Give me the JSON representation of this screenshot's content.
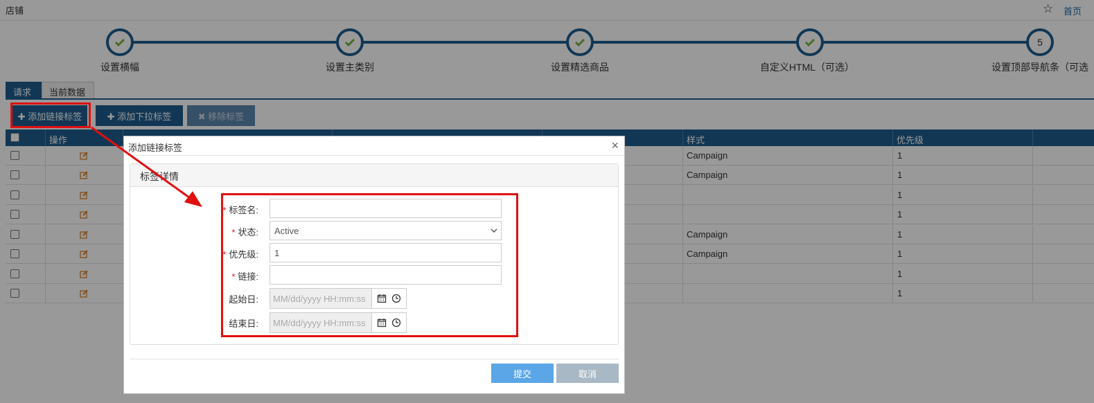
{
  "topbar": {
    "title": "店铺",
    "home": "首页"
  },
  "steps": [
    {
      "label": "设置横幅",
      "done": true
    },
    {
      "label": "设置主类别",
      "done": true
    },
    {
      "label": "设置精选商品",
      "done": true
    },
    {
      "label": "自定义HTML（可选）",
      "done": true
    },
    {
      "label": "设置顶部导航条（可选",
      "done": false,
      "number": "5"
    }
  ],
  "tabs": [
    {
      "label": "请求"
    },
    {
      "label": "当前数据"
    }
  ],
  "toolbar": {
    "add_link_label": "✚ 添加链接标签",
    "add_dropdown_label": "✚ 添加下拉标签",
    "remove_label": "✖ 移除标签"
  },
  "table": {
    "columns": [
      "操作",
      "",
      "",
      "样式",
      "优先级"
    ],
    "rows": [
      {
        "style": "Campaign",
        "priority": "1"
      },
      {
        "style": "Campaign",
        "priority": "1"
      },
      {
        "style": "",
        "priority": "1"
      },
      {
        "style": "",
        "priority": "1"
      },
      {
        "style": "Campaign",
        "priority": "1"
      },
      {
        "style": "Campaign",
        "priority": "1"
      },
      {
        "style": "",
        "priority": "1"
      },
      {
        "style": "",
        "priority": "1"
      }
    ]
  },
  "dialog": {
    "title": "添加链接标签",
    "panel_title": "标签详情",
    "fields": {
      "tag_name_label": "标签名:",
      "status_label": "状态:",
      "status_value": "Active",
      "priority_label": "优先级:",
      "priority_value": "1",
      "link_label": "链接:",
      "start_label": "起始日:",
      "start_placeholder": "MM/dd/yyyy HH:mm:ss",
      "end_label": "结束日:",
      "end_placeholder": "MM/dd/yyyy HH:mm:ss"
    },
    "submit_label": "提交",
    "cancel_label": "取消"
  },
  "colors": {
    "primary": "#1e5d8e",
    "annotation": "#e01010",
    "submit": "#5aa6e6"
  }
}
